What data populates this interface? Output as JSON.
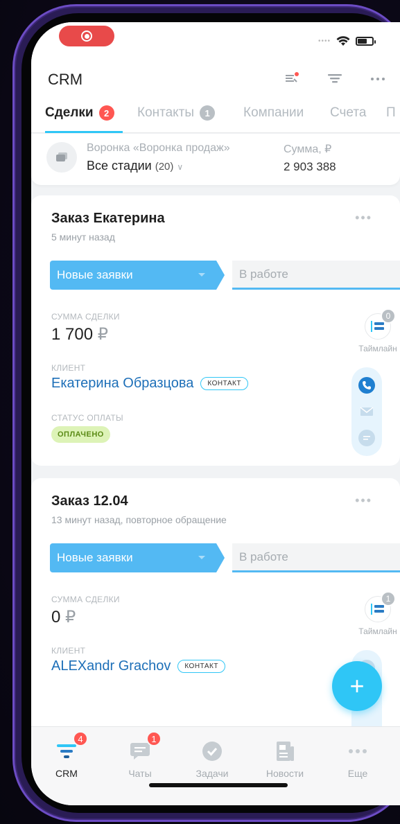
{
  "app": {
    "title": "CRM"
  },
  "tabs": [
    {
      "label": "Сделки",
      "badge": "2"
    },
    {
      "label": "Контакты",
      "badge": "1"
    },
    {
      "label": "Компании"
    },
    {
      "label": "Счета"
    },
    {
      "label": "П"
    }
  ],
  "funnel": {
    "label": "Воронка «Воронка продаж»",
    "stage": "Все стадии",
    "count": "(20)",
    "sum_label": "Сумма, ₽",
    "sum_value": "2 903 388"
  },
  "deals": [
    {
      "title": "Заказ Екатерина",
      "subtitle": "5 минут назад",
      "stage": "Новые заявки",
      "next_stage": "В работе",
      "sum_label": "СУММА СДЕЛКИ",
      "sum": "1 700",
      "currency": "₽",
      "client_label": "КЛИЕНТ",
      "client": "Екатерина Образцова",
      "client_tag": "КОНТАКТ",
      "payment_label": "СТАТУС ОПЛАТЫ",
      "payment_status": "ОПЛАЧЕНО",
      "timeline_label": "Таймлайн",
      "timeline_count": "0"
    },
    {
      "title": "Заказ 12.04",
      "subtitle": "13 минут назад, повторное обращение",
      "stage": "Новые заявки",
      "next_stage": "В работе",
      "sum_label": "СУММА СДЕЛКИ",
      "sum": "0",
      "currency": "₽",
      "client_label": "КЛИЕНТ",
      "client": "ALEXandr Grachov",
      "client_tag": "КОНТАКТ",
      "timeline_label": "Таймлайн",
      "timeline_count": "1"
    }
  ],
  "fab": {
    "label": "+"
  },
  "bottom_nav": [
    {
      "label": "CRM",
      "badge": "4",
      "icon": "crm-funnel-icon"
    },
    {
      "label": "Чаты",
      "badge": "1",
      "icon": "chat-icon"
    },
    {
      "label": "Задачи",
      "icon": "check-icon"
    },
    {
      "label": "Новости",
      "icon": "news-icon"
    },
    {
      "label": "Еще",
      "icon": "more-icon"
    }
  ],
  "colors": {
    "accent": "#2fc6f6",
    "stage_blue": "#53b9f3",
    "badge_red": "#ff5752",
    "link_blue": "#1d6fb8",
    "paid_bg": "#ddf3b7",
    "recording_red": "#e84a4a"
  }
}
